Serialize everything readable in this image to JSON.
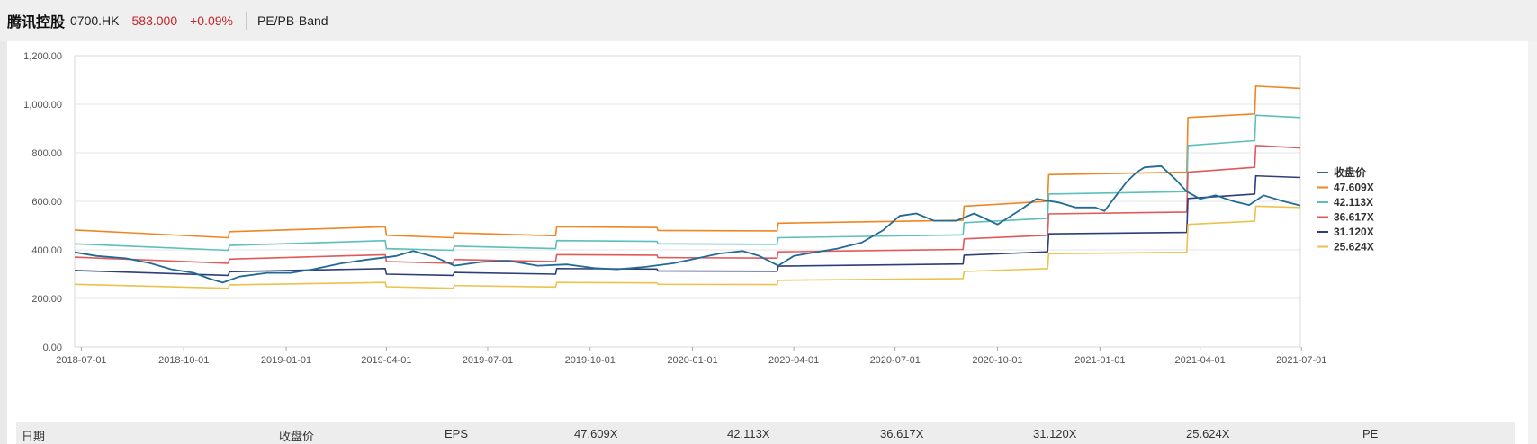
{
  "header": {
    "name": "腾讯控股",
    "code": "0700.HK",
    "price": "583.000",
    "change": "+0.09%",
    "title": "PE/PB-Band"
  },
  "table": {
    "columns": [
      "日期",
      "收盘价",
      "EPS",
      "47.609X",
      "42.113X",
      "36.617X",
      "31.120X",
      "25.624X",
      "PE"
    ]
  },
  "chart_data": {
    "type": "line",
    "title": "",
    "xlabel": "",
    "ylabel": "",
    "x_ticks": [
      "2018-07-01",
      "2018-10-01",
      "2019-01-01",
      "2019-04-01",
      "2019-07-01",
      "2019-10-01",
      "2020-01-01",
      "2020-04-01",
      "2020-07-01",
      "2020-10-01",
      "2021-01-01",
      "2021-04-01",
      "2021-07-01"
    ],
    "y_ticks": [
      "0.00",
      "200.00",
      "400.00",
      "600.00",
      "800.00",
      "1,000.00",
      "1,200.00"
    ],
    "xlim": [
      "2018-06-25",
      "2021-06-30"
    ],
    "ylim": [
      0,
      1200
    ],
    "grid": "horizontal",
    "legend_position": "right",
    "series": [
      {
        "name": "收盘价",
        "color": "#236b96",
        "points": [
          [
            "2018-06-25",
            390
          ],
          [
            "2018-07-15",
            375
          ],
          [
            "2018-08-10",
            365
          ],
          [
            "2018-09-01",
            345
          ],
          [
            "2018-09-20",
            320
          ],
          [
            "2018-10-10",
            305
          ],
          [
            "2018-10-25",
            280
          ],
          [
            "2018-11-05",
            265
          ],
          [
            "2018-11-20",
            290
          ],
          [
            "2018-12-15",
            305
          ],
          [
            "2019-01-05",
            305
          ],
          [
            "2019-01-25",
            320
          ],
          [
            "2019-02-20",
            345
          ],
          [
            "2019-03-15",
            360
          ],
          [
            "2019-04-10",
            375
          ],
          [
            "2019-04-25",
            395
          ],
          [
            "2019-05-15",
            370
          ],
          [
            "2019-06-01",
            335
          ],
          [
            "2019-06-25",
            350
          ],
          [
            "2019-07-20",
            355
          ],
          [
            "2019-08-15",
            335
          ],
          [
            "2019-09-10",
            340
          ],
          [
            "2019-10-05",
            325
          ],
          [
            "2019-10-25",
            320
          ],
          [
            "2019-11-20",
            330
          ],
          [
            "2019-12-15",
            345
          ],
          [
            "2020-01-10",
            370
          ],
          [
            "2020-01-25",
            385
          ],
          [
            "2020-02-15",
            395
          ],
          [
            "2020-03-01",
            375
          ],
          [
            "2020-03-18",
            335
          ],
          [
            "2020-04-01",
            375
          ],
          [
            "2020-04-20",
            390
          ],
          [
            "2020-05-10",
            405
          ],
          [
            "2020-06-01",
            430
          ],
          [
            "2020-06-20",
            480
          ],
          [
            "2020-07-05",
            540
          ],
          [
            "2020-07-20",
            550
          ],
          [
            "2020-08-05",
            520
          ],
          [
            "2020-08-25",
            520
          ],
          [
            "2020-09-10",
            550
          ],
          [
            "2020-10-01",
            505
          ],
          [
            "2020-10-20",
            560
          ],
          [
            "2020-11-05",
            610
          ],
          [
            "2020-11-25",
            595
          ],
          [
            "2020-12-10",
            575
          ],
          [
            "2020-12-28",
            575
          ],
          [
            "2021-01-05",
            560
          ],
          [
            "2021-01-15",
            620
          ],
          [
            "2021-01-25",
            680
          ],
          [
            "2021-02-03",
            720
          ],
          [
            "2021-02-10",
            740
          ],
          [
            "2021-02-25",
            745
          ],
          [
            "2021-03-10",
            690
          ],
          [
            "2021-03-20",
            640
          ],
          [
            "2021-04-01",
            610
          ],
          [
            "2021-04-15",
            625
          ],
          [
            "2021-05-01",
            600
          ],
          [
            "2021-05-15",
            585
          ],
          [
            "2021-05-28",
            625
          ],
          [
            "2021-06-15",
            600
          ],
          [
            "2021-06-30",
            583
          ]
        ]
      },
      {
        "name": "47.609X",
        "color": "#f08522",
        "points": [
          [
            "2018-06-25",
            482
          ],
          [
            "2018-11-10",
            450
          ],
          [
            "2018-11-11",
            475
          ],
          [
            "2019-03-31",
            495
          ],
          [
            "2019-04-01",
            460
          ],
          [
            "2019-05-31",
            450
          ],
          [
            "2019-06-01",
            470
          ],
          [
            "2019-08-31",
            458
          ],
          [
            "2019-09-01",
            495
          ],
          [
            "2019-11-30",
            492
          ],
          [
            "2019-12-01",
            480
          ],
          [
            "2020-03-17",
            478
          ],
          [
            "2020-03-18",
            510
          ],
          [
            "2020-08-31",
            522
          ],
          [
            "2020-09-01",
            580
          ],
          [
            "2020-11-15",
            600
          ],
          [
            "2020-11-16",
            710
          ],
          [
            "2021-03-20",
            720
          ],
          [
            "2021-03-21",
            945
          ],
          [
            "2021-05-20",
            960
          ],
          [
            "2021-05-21",
            1075
          ],
          [
            "2021-06-30",
            1065
          ]
        ]
      },
      {
        "name": "42.113X",
        "color": "#5cbfba",
        "points": [
          [
            "2018-06-25",
            425
          ],
          [
            "2018-11-10",
            398
          ],
          [
            "2018-11-11",
            418
          ],
          [
            "2019-03-31",
            438
          ],
          [
            "2019-04-01",
            405
          ],
          [
            "2019-05-31",
            398
          ],
          [
            "2019-06-01",
            415
          ],
          [
            "2019-08-31",
            405
          ],
          [
            "2019-09-01",
            438
          ],
          [
            "2019-11-30",
            435
          ],
          [
            "2019-12-01",
            425
          ],
          [
            "2020-03-17",
            423
          ],
          [
            "2020-03-18",
            450
          ],
          [
            "2020-08-31",
            462
          ],
          [
            "2020-09-01",
            512
          ],
          [
            "2020-11-15",
            530
          ],
          [
            "2020-11-16",
            630
          ],
          [
            "2021-03-20",
            640
          ],
          [
            "2021-03-21",
            830
          ],
          [
            "2021-05-20",
            850
          ],
          [
            "2021-05-21",
            955
          ],
          [
            "2021-06-30",
            945
          ]
        ]
      },
      {
        "name": "36.617X",
        "color": "#e05a5a",
        "points": [
          [
            "2018-06-25",
            370
          ],
          [
            "2018-11-10",
            345
          ],
          [
            "2018-11-11",
            362
          ],
          [
            "2019-03-31",
            380
          ],
          [
            "2019-04-01",
            352
          ],
          [
            "2019-05-31",
            345
          ],
          [
            "2019-06-01",
            360
          ],
          [
            "2019-08-31",
            352
          ],
          [
            "2019-09-01",
            380
          ],
          [
            "2019-11-30",
            378
          ],
          [
            "2019-12-01",
            368
          ],
          [
            "2020-03-17",
            366
          ],
          [
            "2020-03-18",
            392
          ],
          [
            "2020-08-31",
            402
          ],
          [
            "2020-09-01",
            445
          ],
          [
            "2020-11-15",
            460
          ],
          [
            "2020-11-16",
            548
          ],
          [
            "2021-03-20",
            556
          ],
          [
            "2021-03-21",
            720
          ],
          [
            "2021-05-20",
            740
          ],
          [
            "2021-05-21",
            830
          ],
          [
            "2021-06-30",
            820
          ]
        ]
      },
      {
        "name": "31.120X",
        "color": "#2d3e78",
        "points": [
          [
            "2018-06-25",
            315
          ],
          [
            "2018-11-10",
            295
          ],
          [
            "2018-11-11",
            310
          ],
          [
            "2019-03-31",
            323
          ],
          [
            "2019-04-01",
            300
          ],
          [
            "2019-05-31",
            295
          ],
          [
            "2019-06-01",
            307
          ],
          [
            "2019-08-31",
            300
          ],
          [
            "2019-09-01",
            323
          ],
          [
            "2019-11-30",
            321
          ],
          [
            "2019-12-01",
            313
          ],
          [
            "2020-03-17",
            312
          ],
          [
            "2020-03-18",
            333
          ],
          [
            "2020-08-31",
            342
          ],
          [
            "2020-09-01",
            378
          ],
          [
            "2020-11-15",
            392
          ],
          [
            "2020-11-16",
            466
          ],
          [
            "2021-03-20",
            472
          ],
          [
            "2021-03-21",
            612
          ],
          [
            "2021-05-20",
            630
          ],
          [
            "2021-05-21",
            705
          ],
          [
            "2021-06-30",
            698
          ]
        ]
      },
      {
        "name": "25.624X",
        "color": "#eac24d",
        "points": [
          [
            "2018-06-25",
            258
          ],
          [
            "2018-11-10",
            242
          ],
          [
            "2018-11-11",
            256
          ],
          [
            "2019-03-31",
            266
          ],
          [
            "2019-04-01",
            248
          ],
          [
            "2019-05-31",
            242
          ],
          [
            "2019-06-01",
            253
          ],
          [
            "2019-08-31",
            247
          ],
          [
            "2019-09-01",
            266
          ],
          [
            "2019-11-30",
            264
          ],
          [
            "2019-12-01",
            258
          ],
          [
            "2020-03-17",
            257
          ],
          [
            "2020-03-18",
            275
          ],
          [
            "2020-08-31",
            282
          ],
          [
            "2020-09-01",
            311
          ],
          [
            "2020-11-15",
            323
          ],
          [
            "2020-11-16",
            384
          ],
          [
            "2021-03-20",
            390
          ],
          [
            "2021-03-21",
            505
          ],
          [
            "2021-05-20",
            518
          ],
          [
            "2021-05-21",
            580
          ],
          [
            "2021-06-30",
            575
          ]
        ]
      }
    ]
  }
}
